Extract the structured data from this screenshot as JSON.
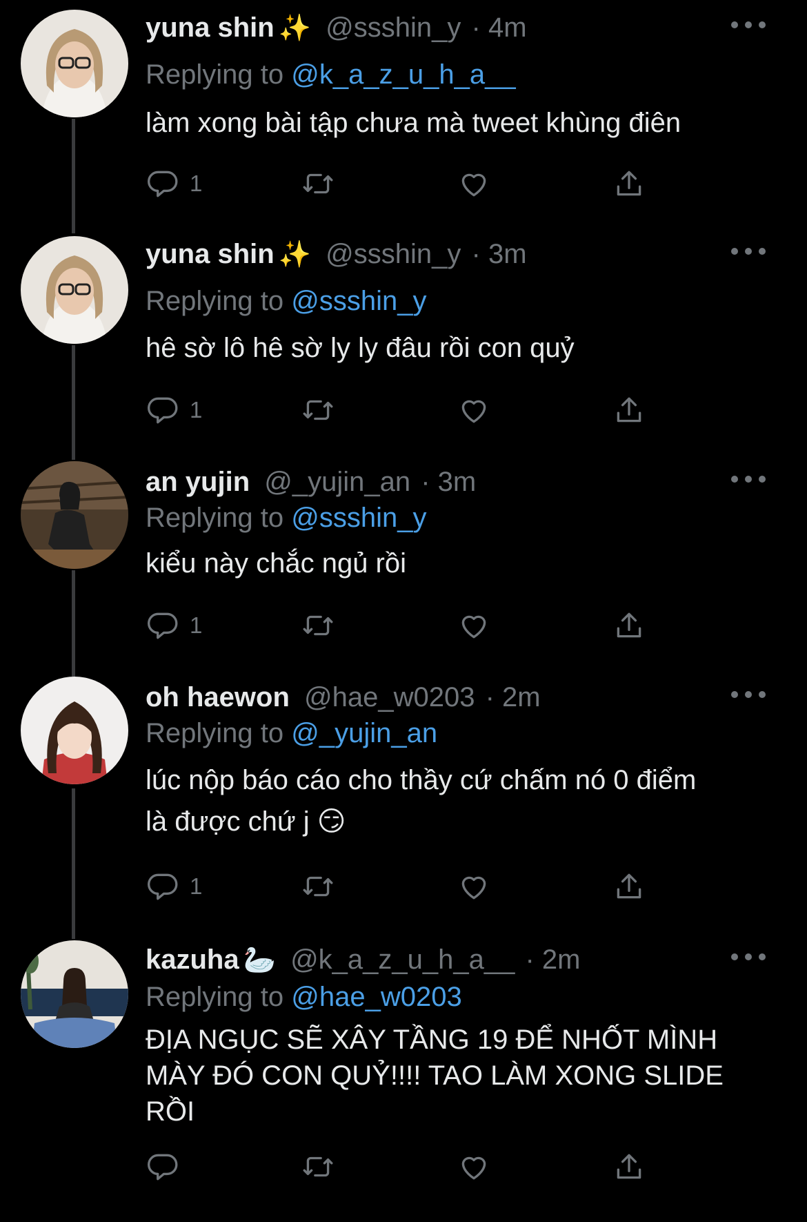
{
  "tweets": [
    {
      "name": "yuna shin",
      "name_emoji": "✨",
      "handle": "@ssshin_y",
      "time": "· 4m",
      "replying_label": "Replying to",
      "replying_to": "@k_a_z_u_h_a__",
      "text": "làm xong bài tập chưa mà tweet khùng điên",
      "reply_count": "1"
    },
    {
      "name": "yuna shin",
      "name_emoji": "✨",
      "handle": "@ssshin_y",
      "time": "· 3m",
      "replying_label": "Replying to",
      "replying_to": "@ssshin_y",
      "text": "hê sờ lô hê sờ ly ly đâu rồi con quỷ",
      "reply_count": "1"
    },
    {
      "name": "an yujin",
      "name_emoji": "",
      "handle": "@_yujin_an",
      "time": "· 3m",
      "replying_label": "Replying to",
      "replying_to": "@ssshin_y",
      "text": "kiểu này chắc ngủ rồi",
      "reply_count": "1"
    },
    {
      "name": "oh haewon",
      "name_emoji": "",
      "handle": "@hae_w0203",
      "time": "· 2m",
      "replying_label": "Replying to",
      "replying_to": "@_yujin_an",
      "text_line1": "lúc nộp báo cáo cho thầy cứ chấm nó 0 điểm",
      "text_line2": "là được chứ j 😏",
      "reply_count": "1"
    },
    {
      "name": "kazuha",
      "name_emoji": "🦢",
      "handle": "@k_a_z_u_h_a__",
      "time": "· 2m",
      "replying_label": "Replying to",
      "replying_to": "@hae_w0203",
      "text_line1": "ĐỊA NGỤC SẼ XÂY TẦNG 19 ĐỂ NHỐT MÌNH",
      "text_line2": "MÀY ĐÓ CON QUỶ!!!! TAO LÀM XONG SLIDE",
      "text_line3": "RỒI",
      "reply_count": ""
    }
  ],
  "colors": {
    "background": "#000000",
    "primary_text": "#e7e9ea",
    "secondary_text": "#71767b",
    "link": "#4b9fe6",
    "thread_line": "#3a3b3d"
  },
  "icons": [
    "more-icon",
    "reply-icon",
    "retweet-icon",
    "like-icon",
    "share-icon"
  ]
}
